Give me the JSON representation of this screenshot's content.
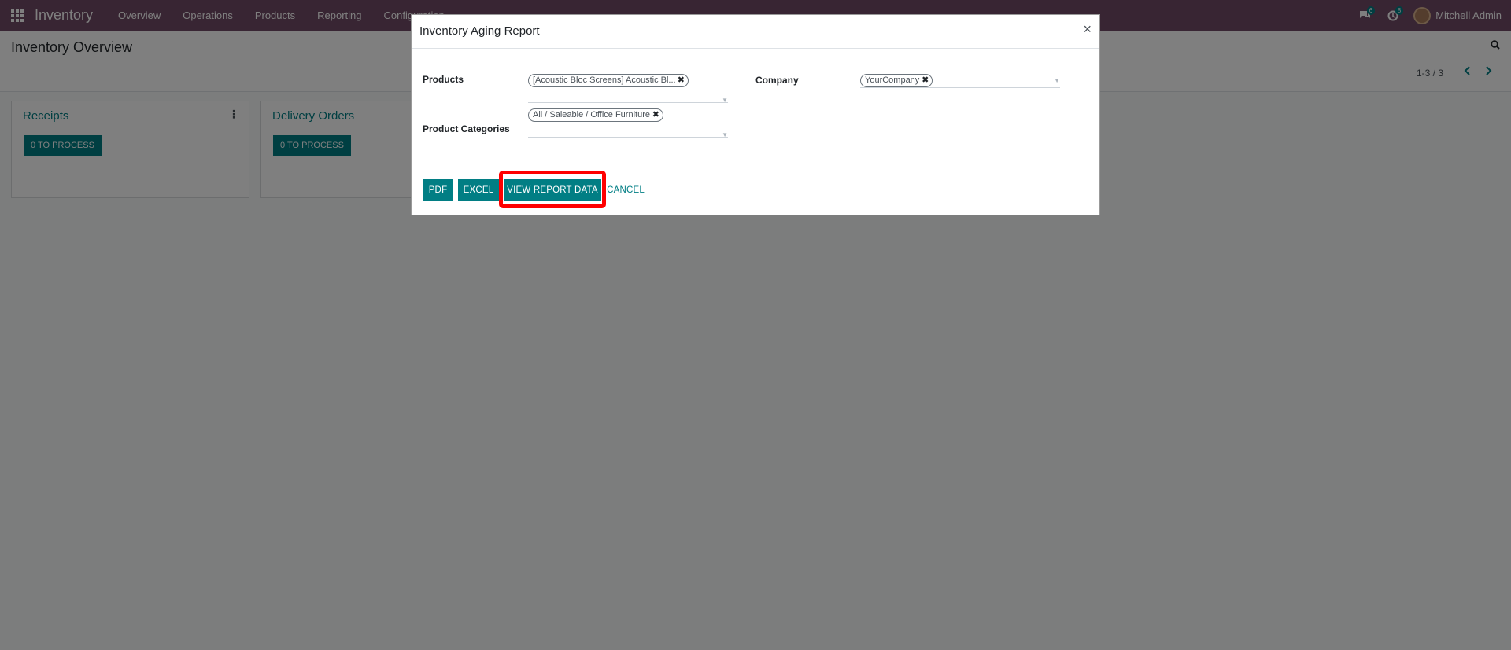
{
  "navbar": {
    "brand": "Inventory",
    "menu": [
      "Overview",
      "Operations",
      "Products",
      "Reporting",
      "Configuration"
    ],
    "messages_count": "6",
    "activities_count": "8",
    "user_name": "Mitchell Admin",
    "color": "#714B67"
  },
  "control_panel": {
    "title": "Inventory Overview",
    "pager": "1-3 / 3"
  },
  "kanban": {
    "cards": [
      {
        "title": "Receipts",
        "button": "0 TO PROCESS"
      },
      {
        "title": "Delivery Orders",
        "button": "0 TO PROCESS"
      }
    ]
  },
  "dialog": {
    "title": "Inventory Aging Report",
    "close": "×",
    "fields": {
      "products_label": "Products",
      "products_tag": "[Acoustic Bloc Screens] Acoustic Bl...",
      "categories_label": "Product Categories",
      "categories_tag": "All / Saleable / Office Furniture",
      "company_label": "Company",
      "company_tag": "YourCompany"
    },
    "buttons": {
      "pdf": "PDF",
      "excel": "EXCEL",
      "view": "VIEW REPORT DATA",
      "cancel": "CANCEL"
    },
    "accent": "#017e84",
    "highlight_color": "#ff0000"
  }
}
